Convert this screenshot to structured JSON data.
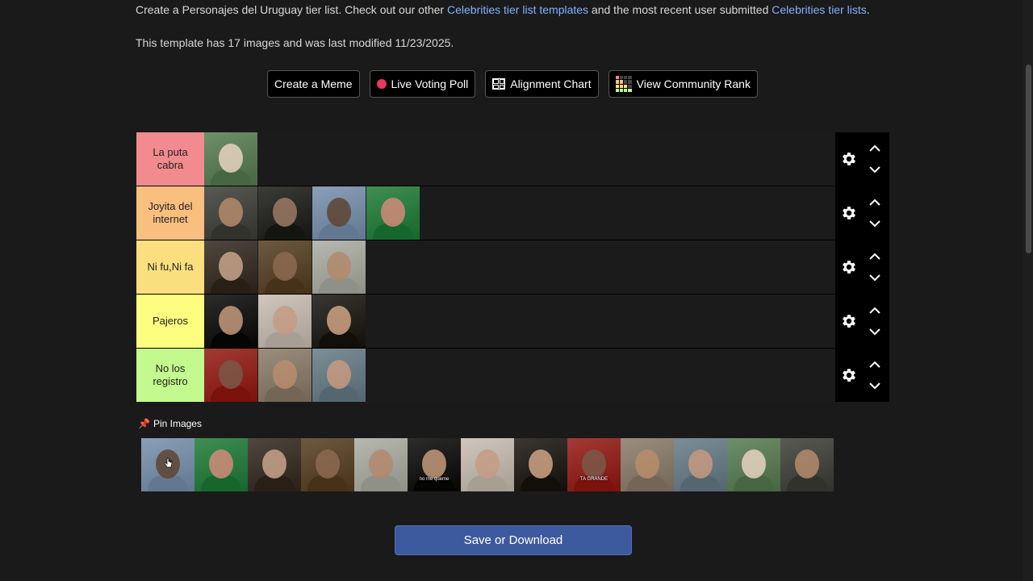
{
  "intro": {
    "prefix": "Create a Personajes del Uruguay tier list. Check out our other ",
    "link1": "Celebrities tier list templates",
    "middle": " and the most recent user submitted ",
    "link2": "Celebrities tier lists",
    "suffix": "."
  },
  "meta": "This template has 17 images and was last modified 11/23/2025.",
  "buttons": {
    "meme": "Create a Meme",
    "poll": "Live Voting Poll",
    "alignment": "Alignment Chart",
    "community": "View Community Rank"
  },
  "tiers": [
    {
      "label": "La puta cabra",
      "color": "#f28b8f",
      "count": 1
    },
    {
      "label": "Joyita del internet",
      "color": "#f8bf7f",
      "count": 4
    },
    {
      "label": "Ni fu,Ni fa",
      "color": "#fbdf7f",
      "count": 3
    },
    {
      "label": "Pajeros",
      "color": "#fdfd7f",
      "count": 3
    },
    {
      "label": "No los registro",
      "color": "#c3f98d",
      "count": 3
    }
  ],
  "pin_images_label": "Pin Images",
  "pool_count": 13,
  "pool_captions": [
    "",
    "",
    "",
    "",
    "",
    "no me queme",
    "",
    "",
    "TA GRANDE",
    "",
    "",
    "",
    ""
  ],
  "save_label": "Save or Download"
}
